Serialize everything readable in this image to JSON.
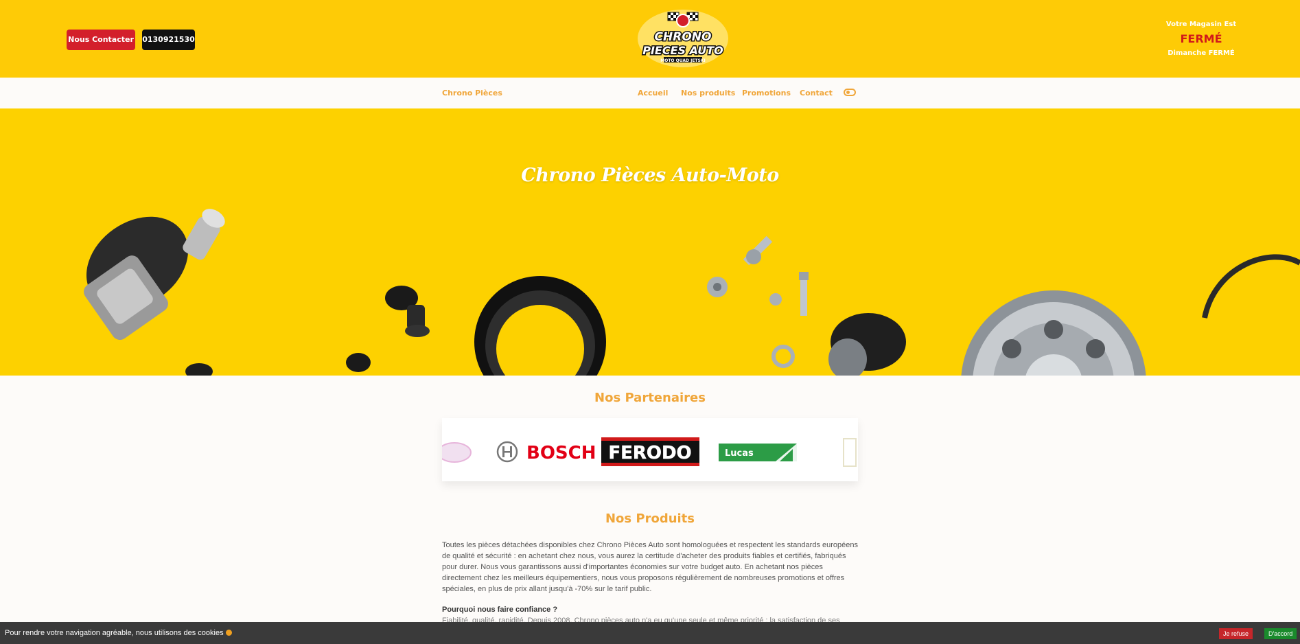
{
  "header": {
    "contact_button": "Nous Contacter",
    "phone_button": "0130921530",
    "logo": {
      "line1": "CHRONO",
      "line2": "PIECES AUTO",
      "tagline": "MOTO QUAD JETSKI"
    },
    "store_status": {
      "label": "Votre Magasin Est",
      "status": "FERMÉ",
      "today": "Dimanche FERMÉ"
    }
  },
  "nav": {
    "brand": "Chrono Pièces",
    "items": [
      {
        "label": "Accueil"
      },
      {
        "label": "Nos produits"
      },
      {
        "label": "Promotions"
      },
      {
        "label": "Contact"
      }
    ]
  },
  "hero": {
    "title": "Chrono Pièces Auto-Moto"
  },
  "partners": {
    "title": "Nos Partenaires",
    "logos": [
      "BOSCH",
      "FERODO",
      "Lucas"
    ]
  },
  "products": {
    "title": "Nos Produits",
    "paragraph": "Toutes les pièces détachées disponibles chez Chrono Pièces Auto sont homologuées et respectent les standards européens de qualité et sécurité : en achetant chez nous, vous aurez la certitude d'acheter des produits fiables et certifiés, fabriqués pour durer. Nous vous garantissons aussi d'importantes économies sur votre budget auto. En achetant nos pièces directement chez les meilleurs équipementiers, nous vous proposons régulièrement de nombreuses promotions et offres spéciales, en plus de prix allant jusqu'à -70% sur le tarif public.",
    "why_title": "Pourquoi nous faire confiance ?",
    "why_text": "Fiabilité, qualité, rapidité. Depuis 2008, Chrono pièces auto n'a eu qu'une seule et même priorité : la satisfaction de ses"
  },
  "cookie": {
    "text": "Pour rendre votre navigation agréable, nous utilisons des cookies",
    "refuse": "Je refuse",
    "accept": "D'accord"
  },
  "colors": {
    "brand_yellow": "#fecb06",
    "accent_orange": "#f0a63a",
    "contact_red": "#d31f2b",
    "closed_red": "#d11a1a"
  }
}
